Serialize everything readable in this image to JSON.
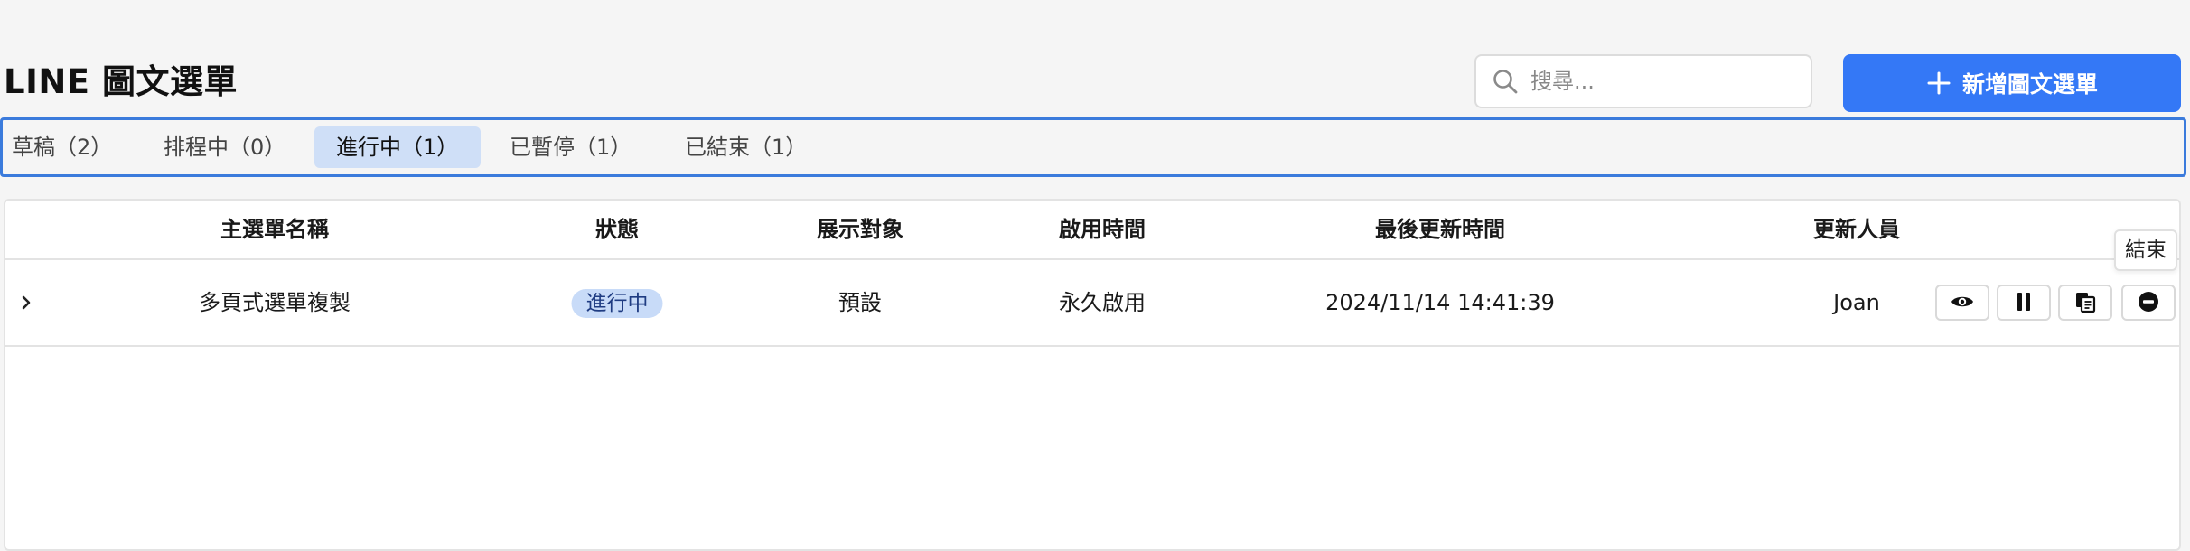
{
  "page": {
    "title": "LINE 圖文選單"
  },
  "search": {
    "placeholder": "搜尋..."
  },
  "add_button": {
    "label": "新增圖文選單"
  },
  "tabs": [
    {
      "label": "草稿（2）",
      "active": false
    },
    {
      "label": "排程中（0）",
      "active": false
    },
    {
      "label": "進行中（1）",
      "active": true
    },
    {
      "label": "已暫停（1）",
      "active": false
    },
    {
      "label": "已結束（1）",
      "active": false
    }
  ],
  "table": {
    "columns": [
      "主選單名稱",
      "狀態",
      "展示對象",
      "啟用時間",
      "最後更新時間",
      "更新人員"
    ],
    "rows": [
      {
        "name": "多頁式選單複製",
        "status": "進行中",
        "audience": "預設",
        "enable_time": "永久啟用",
        "last_updated": "2024/11/14 14:41:39",
        "updated_by": "Joan"
      }
    ]
  },
  "tooltip": {
    "text": "結束"
  },
  "colors": {
    "accent": "#3478f6",
    "tab_active_bg": "#cfdff7",
    "status_badge_bg": "#c8dbf8",
    "status_badge_text": "#1f3c82"
  },
  "icons": {
    "search": "search-icon",
    "add": "plus-icon",
    "expand": "chevron-right-icon",
    "view": "eye-icon",
    "pause": "pause-icon",
    "copy": "copy-icon",
    "end": "minus-circle-icon"
  }
}
